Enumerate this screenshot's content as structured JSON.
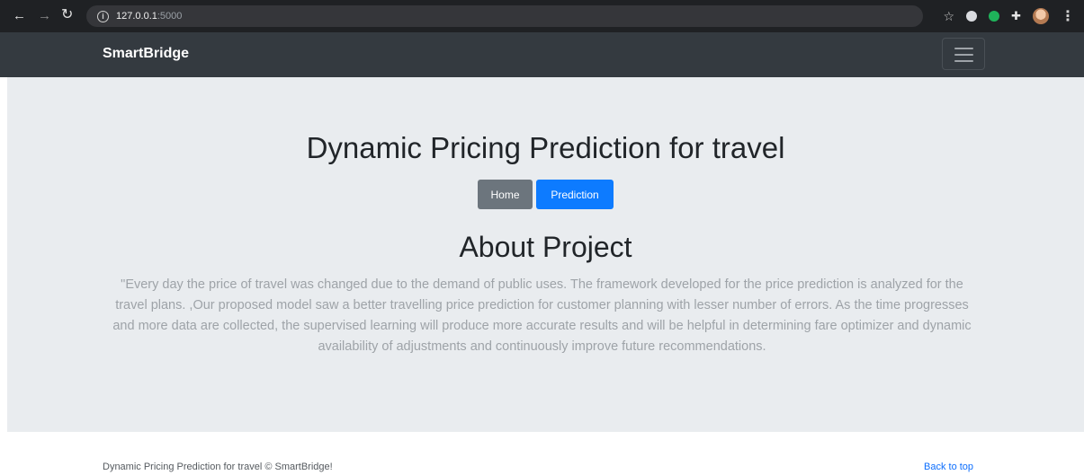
{
  "browser": {
    "url_host": "127.0.0.1",
    "url_port": ":5000",
    "icons": {
      "back": "arrow-left-icon",
      "forward": "arrow-right-icon",
      "reload": "reload-icon",
      "info": "info-icon",
      "bookmark": "star-icon",
      "extensions": "puzzle-icon",
      "menu": "kebab-menu-icon"
    },
    "colors": {
      "chrome": "#1f2124",
      "omnibox": "#35363a"
    }
  },
  "navbar": {
    "brand": "SmartBridge",
    "toggler_icon": "hamburger-icon",
    "background": "#343a40"
  },
  "hero": {
    "title": "Dynamic Pricing Prediction for travel",
    "buttons": {
      "home": "Home",
      "prediction": "Prediction"
    },
    "about_heading": "About Project",
    "description": "\"Every day the price of travel was changed due to the demand of public uses. The framework developed for the price prediction is analyzed for the travel plans. ,Our proposed model saw a better travelling price prediction for customer planning with lesser number of errors. As the time progresses and more data are collected, the supervised learning will produce more accurate results and will be helpful in determining fare optimizer and dynamic availability of adjustments and continuously improve future recommendations.",
    "colors": {
      "background": "#e9ecef",
      "home_button": "#6c757d",
      "prediction_button": "#0d7bff"
    }
  },
  "footer": {
    "copyright": "Dynamic Pricing Prediction for travel © SmartBridge!",
    "back_to_top": "Back to top"
  }
}
